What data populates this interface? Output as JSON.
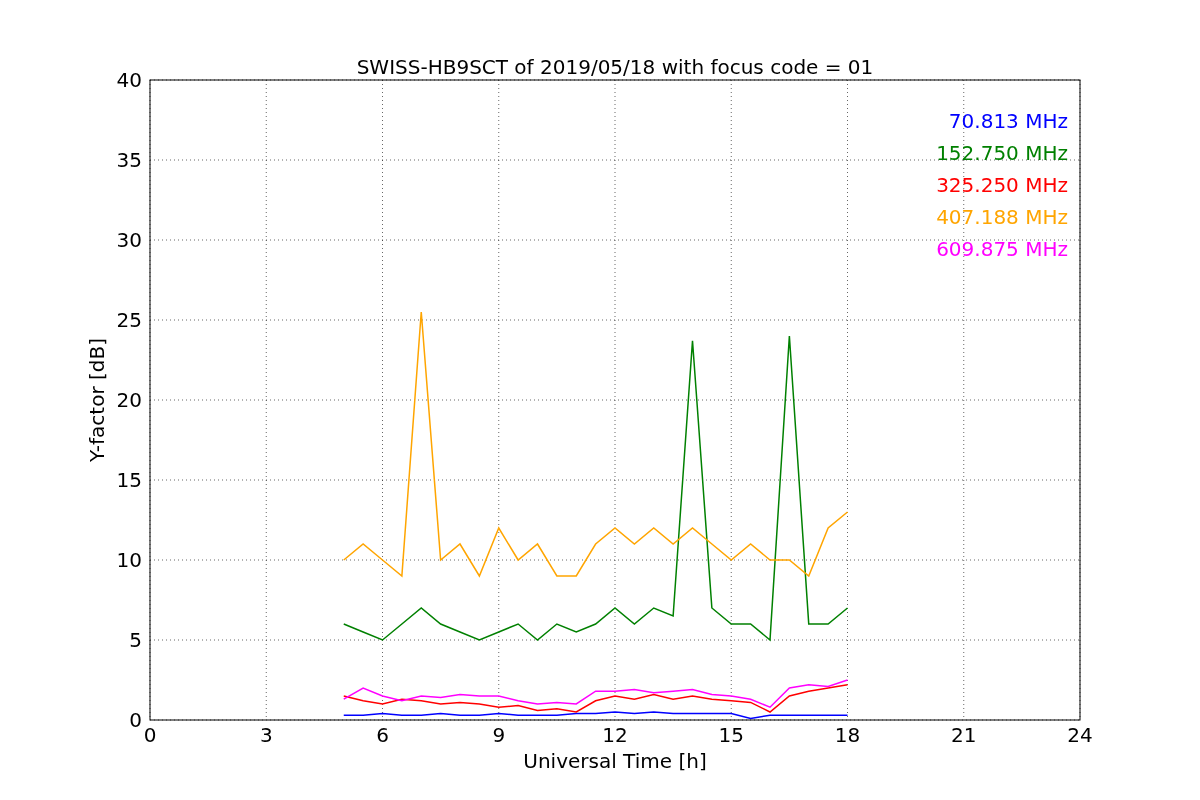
{
  "chart_data": {
    "type": "line",
    "title": "SWISS-HB9SCT of 2019/05/18 with focus code = 01",
    "xlabel": "Universal Time [h]",
    "ylabel": "Y-factor [dB]",
    "x": [
      5,
      5.5,
      6,
      6.5,
      7,
      7.5,
      8,
      8.5,
      9,
      9.5,
      10,
      10.5,
      11,
      11.5,
      12,
      12.5,
      13,
      13.5,
      14,
      14.5,
      15,
      15.5,
      16,
      16.5,
      17,
      17.5,
      18
    ],
    "series": [
      {
        "name": "70.813 MHz",
        "color": "#0000ff",
        "values": [
          0.3,
          0.3,
          0.4,
          0.3,
          0.3,
          0.4,
          0.3,
          0.3,
          0.4,
          0.3,
          0.3,
          0.3,
          0.4,
          0.4,
          0.5,
          0.4,
          0.5,
          0.4,
          0.4,
          0.4,
          0.4,
          0.1,
          0.3,
          0.3,
          0.3,
          0.3,
          0.3
        ]
      },
      {
        "name": "152.750 MHz",
        "color": "#008000",
        "values": [
          6,
          5.5,
          5,
          6,
          7,
          6,
          5.5,
          5,
          5.5,
          6,
          5,
          6,
          5.5,
          6,
          7,
          6,
          7,
          6.5,
          23.7,
          7,
          6,
          6,
          5,
          24,
          6,
          6,
          7
        ]
      },
      {
        "name": "325.250 MHz",
        "color": "#ff0000",
        "values": [
          1.5,
          1.2,
          1,
          1.3,
          1.2,
          1,
          1.1,
          1,
          0.8,
          0.9,
          0.6,
          0.7,
          0.5,
          1.2,
          1.5,
          1.3,
          1.6,
          1.3,
          1.5,
          1.3,
          1.2,
          1.1,
          0.5,
          1.5,
          1.8,
          2,
          2.2
        ]
      },
      {
        "name": "407.188 MHz",
        "color": "#ffa500",
        "values": [
          10,
          11,
          10,
          9,
          25.5,
          10,
          11,
          9,
          12,
          10,
          11,
          9,
          9,
          11,
          12,
          11,
          12,
          11,
          12,
          11,
          10,
          11,
          10,
          10,
          9,
          12,
          13
        ]
      },
      {
        "name": "609.875 MHz",
        "color": "#ff00ff",
        "values": [
          1.3,
          2,
          1.5,
          1.2,
          1.5,
          1.4,
          1.6,
          1.5,
          1.5,
          1.2,
          1,
          1.1,
          1,
          1.8,
          1.8,
          1.9,
          1.7,
          1.8,
          1.9,
          1.6,
          1.5,
          1.3,
          0.8,
          2,
          2.2,
          2.1,
          2.5
        ]
      }
    ],
    "grid": true,
    "xlim": [
      0,
      24
    ],
    "ylim": [
      0,
      40
    ],
    "xticks": [
      0,
      3,
      6,
      9,
      12,
      15,
      18,
      21,
      24
    ],
    "yticks": [
      0,
      5,
      10,
      15,
      20,
      25,
      30,
      35,
      40
    ]
  }
}
